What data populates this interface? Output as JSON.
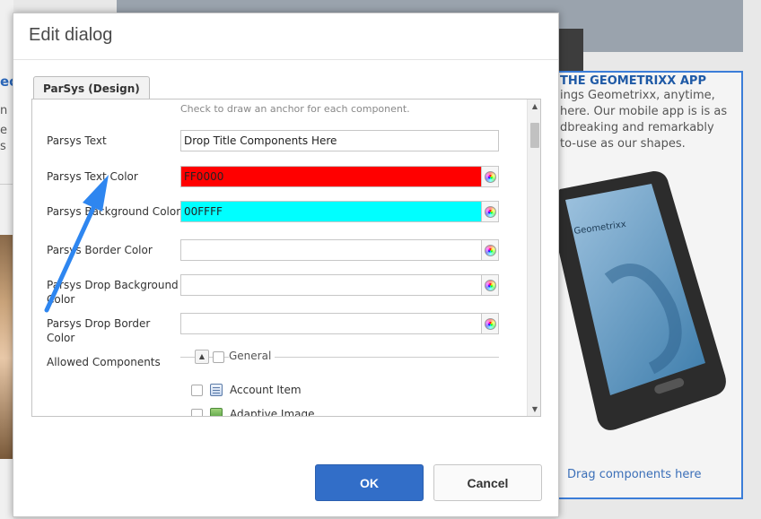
{
  "background": {
    "left_heading": "ec",
    "left_lines": [
      "n",
      "e",
      "s"
    ],
    "promo": {
      "title": "THE GEOMETRIXX APP",
      "lines": [
        "ings Geometrixx, anytime,",
        "here. Our mobile app is is as",
        "dbreaking and remarkably",
        "to-use as our shapes."
      ],
      "phone_brand": "Geometrixx",
      "drag_text": "Drag components here"
    }
  },
  "dialog": {
    "title": "Edit dialog",
    "tab": "ParSys (Design)",
    "hint": "Check to draw an anchor for each component.",
    "fields": {
      "parsys_text": {
        "label": "Parsys Text",
        "value": "Drop Title Components Here"
      },
      "text_color": {
        "label": "Parsys Text Color",
        "value": "FF0000",
        "color": "#FF0000"
      },
      "bg_color": {
        "label": "Parsys Background Color",
        "value": "00FFFF",
        "color": "#00FFFF"
      },
      "border_color": {
        "label": "Parsys Border Color",
        "value": ""
      },
      "drop_bg_color": {
        "label": "Parsys Drop Background Color",
        "value": ""
      },
      "drop_border_color": {
        "label": "Parsys Drop Border Color",
        "value": ""
      },
      "allowed": {
        "label": "Allowed Components"
      }
    },
    "group": {
      "toggle_glyph": "▲",
      "legend": "General",
      "items": [
        {
          "label": "Account Item",
          "icon": "component-icon"
        },
        {
          "label": "Adaptive Image",
          "icon": "image-icon"
        }
      ]
    },
    "scroll_up_glyph": "▲",
    "scroll_down_glyph": "▼",
    "ok_label": "OK",
    "cancel_label": "Cancel"
  },
  "colors": {
    "accent": "#326EC8",
    "annotation_arrow": "#2E86F0"
  }
}
